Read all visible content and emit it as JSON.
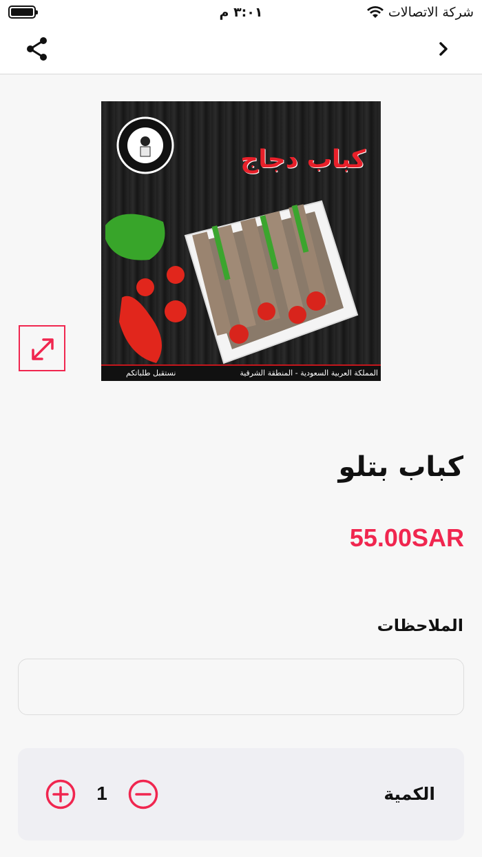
{
  "status_bar": {
    "time": "٣:٠١ م",
    "carrier": "شركة الاتصالات"
  },
  "nav": {
    "share_icon": "share-icon",
    "back_icon": "chevron-right-icon"
  },
  "product": {
    "image_title": "كباب دجاج",
    "image_footer_right": "المملكة العربية السعودية - المنطقة الشرقية",
    "image_footer_left": "نستقبل طلباتكم",
    "name": "كباب بتلو",
    "price": "55.00SAR"
  },
  "notes": {
    "label": "الملاحظات",
    "value": "",
    "placeholder": ""
  },
  "quantity": {
    "label": "الكمية",
    "value": "1"
  },
  "colors": {
    "accent": "#f0264f",
    "background": "#f7f7f7",
    "panel": "#efeff3"
  }
}
